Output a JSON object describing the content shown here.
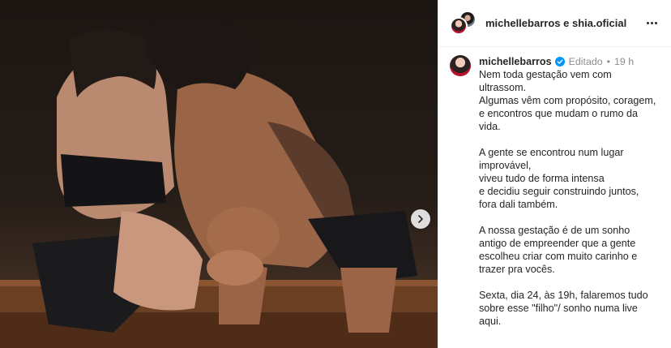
{
  "post": {
    "header": {
      "user1": "michellebarros",
      "conjunction": "e",
      "user2": "shia.oficial",
      "more_icon": "more-horizontal-icon"
    },
    "media": {
      "next_icon": "chevron-right-icon"
    },
    "caption": {
      "username": "michellebarros",
      "verified_icon": "verified-badge-icon",
      "edited_label": "Editado",
      "separator": "•",
      "time": "19 h",
      "lines": [
        "Nem toda gestação vem com",
        "ultrassom.",
        "Algumas vêm com propósito, coragem,",
        "e encontros que mudam o rumo da",
        "vida.",
        "",
        "A gente se encontrou num lugar",
        "improvável,",
        "viveu tudo de forma intensa",
        "e decidiu seguir construindo juntos,",
        "fora dali também.",
        "",
        "A nossa gestação é de um sonho",
        "antigo de empreender que a gente",
        "escolheu criar com muito carinho e",
        "trazer pra vocês.",
        "",
        "Sexta, dia 24, às 19h, falaremos tudo",
        "sobre esse \"filho\"/ sonho numa live",
        "aqui."
      ]
    },
    "colors": {
      "verified": "#0095f6",
      "text": "#262626",
      "muted": "#8e8e8e",
      "border": "#efefef"
    }
  }
}
